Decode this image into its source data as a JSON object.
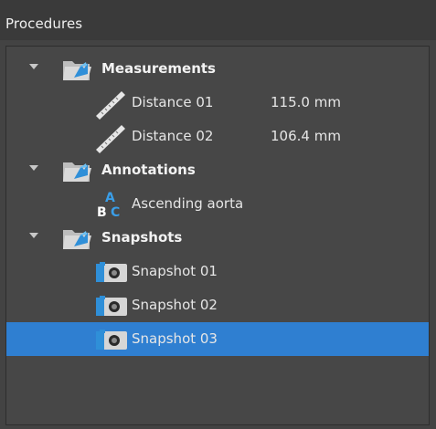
{
  "panel": {
    "title": "Procedures"
  },
  "tree": {
    "groups": [
      {
        "label": "Measurements",
        "icon": "folder-icon",
        "expanded": true,
        "items": [
          {
            "label": "Distance 01",
            "value": "115.0 mm",
            "icon": "ruler-icon"
          },
          {
            "label": "Distance 02",
            "value": "106.4 mm",
            "icon": "ruler-icon"
          }
        ]
      },
      {
        "label": "Annotations",
        "icon": "folder-icon",
        "expanded": true,
        "items": [
          {
            "label": "Ascending aorta",
            "icon": "text-annotation-icon"
          }
        ]
      },
      {
        "label": "Snapshots",
        "icon": "folder-icon",
        "expanded": true,
        "items": [
          {
            "label": "Snapshot 01",
            "icon": "camera-icon"
          },
          {
            "label": "Snapshot 02",
            "icon": "camera-icon"
          },
          {
            "label": "Snapshot 03",
            "icon": "camera-icon",
            "selected": true
          }
        ]
      }
    ]
  },
  "colors": {
    "selection": "#2f7fd1",
    "panel_bg": "#474747",
    "header_bg": "#3a3a3a",
    "folder": "#c9c9c9",
    "folder_accent": "#2f8fd8"
  }
}
